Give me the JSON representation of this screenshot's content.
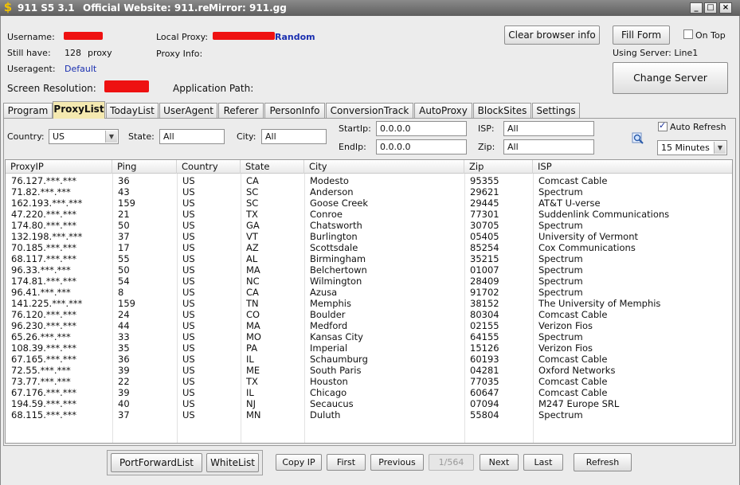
{
  "window": {
    "app_name": "911 S5 3.1",
    "website": "Official Website: 911.re",
    "mirror": "Mirror: 911.gg",
    "controls": [
      "_",
      "□",
      "×"
    ]
  },
  "info": {
    "username_label": "Username:",
    "still_have_label": "Still have:",
    "still_have_value": "128",
    "still_have_unit": "proxy",
    "useragent_label": "Useragent:",
    "useragent_value": "Default",
    "screen_res_label": "Screen Resolution:",
    "local_proxy_label": "Local Proxy:",
    "local_proxy_link": "Random",
    "proxy_info_label": "Proxy Info:",
    "app_path_label": "Application Path:",
    "using_server": "Using Server: Line1"
  },
  "buttons": {
    "clear_browser": "Clear browser info",
    "fill_form": "Fill Form",
    "on_top": "On Top",
    "change_server": "Change Server"
  },
  "tabs": [
    {
      "label": "Program",
      "active": false
    },
    {
      "label": "ProxyList",
      "active": true
    },
    {
      "label": "TodayList",
      "active": false
    },
    {
      "label": "UserAgent",
      "active": false
    },
    {
      "label": "Referer",
      "active": false
    },
    {
      "label": "PersonInfo",
      "active": false
    },
    {
      "label": "ConversionTrack",
      "active": false
    },
    {
      "label": "AutoProxy",
      "active": false
    },
    {
      "label": "BlockSites",
      "active": false
    },
    {
      "label": "Settings",
      "active": false
    }
  ],
  "filters": {
    "country_label": "Country:",
    "country_value": "US",
    "state_label": "State:",
    "state_value": "All",
    "city_label": "City:",
    "city_value": "All",
    "startip_label": "StartIp:",
    "startip_value": "0.0.0.0",
    "endip_label": "EndIp:",
    "endip_value": "0.0.0.0",
    "isp_label": "ISP:",
    "isp_value": "All",
    "zip_label": "Zip:",
    "zip_value": "All",
    "auto_refresh_label": "Auto Refresh",
    "auto_refresh_checked": true,
    "refresh_interval": "15 Minutes"
  },
  "table": {
    "columns": [
      "ProxyIP",
      "Ping",
      "Country",
      "State",
      "City",
      "Zip",
      "ISP"
    ],
    "rows": [
      [
        "76.127.***.***",
        "36",
        "US",
        "CA",
        "Modesto",
        "95355",
        "Comcast Cable"
      ],
      [
        "71.82.***.***",
        "43",
        "US",
        "SC",
        "Anderson",
        "29621",
        "Spectrum"
      ],
      [
        "162.193.***.***",
        "159",
        "US",
        "SC",
        "Goose Creek",
        "29445",
        "AT&T U-verse"
      ],
      [
        "47.220.***.***",
        "21",
        "US",
        "TX",
        "Conroe",
        "77301",
        "Suddenlink Communications"
      ],
      [
        "174.80.***.***",
        "50",
        "US",
        "GA",
        "Chatsworth",
        "30705",
        "Spectrum"
      ],
      [
        "132.198.***.***",
        "37",
        "US",
        "VT",
        "Burlington",
        "05405",
        "University of Vermont"
      ],
      [
        "70.185.***.***",
        "17",
        "US",
        "AZ",
        "Scottsdale",
        "85254",
        "Cox Communications"
      ],
      [
        "68.117.***.***",
        "55",
        "US",
        "AL",
        "Birmingham",
        "35215",
        "Spectrum"
      ],
      [
        "96.33.***.***",
        "50",
        "US",
        "MA",
        "Belchertown",
        "01007",
        "Spectrum"
      ],
      [
        "174.81.***.***",
        "54",
        "US",
        "NC",
        "Wilmington",
        "28409",
        "Spectrum"
      ],
      [
        "96.41.***.***",
        "8",
        "US",
        "CA",
        "Azusa",
        "91702",
        "Spectrum"
      ],
      [
        "141.225.***.***",
        "159",
        "US",
        "TN",
        "Memphis",
        "38152",
        "The University of Memphis"
      ],
      [
        "76.120.***.***",
        "24",
        "US",
        "CO",
        "Boulder",
        "80304",
        "Comcast Cable"
      ],
      [
        "96.230.***.***",
        "44",
        "US",
        "MA",
        "Medford",
        "02155",
        "Verizon Fios"
      ],
      [
        "65.26.***.***",
        "33",
        "US",
        "MO",
        "Kansas City",
        "64155",
        "Spectrum"
      ],
      [
        "108.39.***.***",
        "35",
        "US",
        "PA",
        "Imperial",
        "15126",
        "Verizon Fios"
      ],
      [
        "67.165.***.***",
        "36",
        "US",
        "IL",
        "Schaumburg",
        "60193",
        "Comcast Cable"
      ],
      [
        "72.55.***.***",
        "39",
        "US",
        "ME",
        "South Paris",
        "04281",
        "Oxford Networks"
      ],
      [
        "73.77.***.***",
        "22",
        "US",
        "TX",
        "Houston",
        "77035",
        "Comcast Cable"
      ],
      [
        "67.176.***.***",
        "39",
        "US",
        "IL",
        "Chicago",
        "60647",
        "Comcast Cable"
      ],
      [
        "194.59.***.***",
        "40",
        "US",
        "NJ",
        "Secaucus",
        "07094",
        "M247 Europe SRL"
      ],
      [
        "68.115.***.***",
        "37",
        "US",
        "MN",
        "Duluth",
        "55804",
        "Spectrum"
      ]
    ]
  },
  "bottom": {
    "port_forward": "PortForwardList",
    "white_list": "WhiteList",
    "copy_ip": "Copy IP",
    "first": "First",
    "previous": "Previous",
    "page": "1/564",
    "next": "Next",
    "last": "Last",
    "refresh": "Refresh"
  },
  "colors": {
    "active_tab": "#f4e9b0",
    "link_blue": "#1a2fb0",
    "redaction": "#ee1111",
    "titlebar": "#6e6e6e"
  }
}
